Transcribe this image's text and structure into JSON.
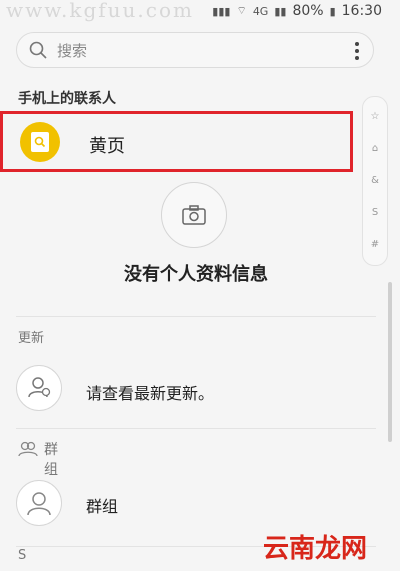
{
  "status": {
    "watermark": "www.kgfuu.com",
    "battery_percent": "80%",
    "time": "16:30"
  },
  "search": {
    "placeholder": "搜索"
  },
  "sections": {
    "phone_contacts": "手机上的联系人",
    "updates": "更新",
    "groups": "群组",
    "s_index": "S"
  },
  "contacts": {
    "yellow_pages": "黄页"
  },
  "profile": {
    "no_profile": "没有个人资料信息"
  },
  "updates": {
    "check_latest": "请查看最新更新。"
  },
  "groups": {
    "label": "群组"
  },
  "side_index": [
    "☆",
    "⌂",
    "&",
    "S",
    "#"
  ],
  "branding": {
    "site_logo": "云南龙网"
  },
  "colors": {
    "highlight": "#e0242b",
    "yellow_pages_icon": "#f1c100"
  }
}
